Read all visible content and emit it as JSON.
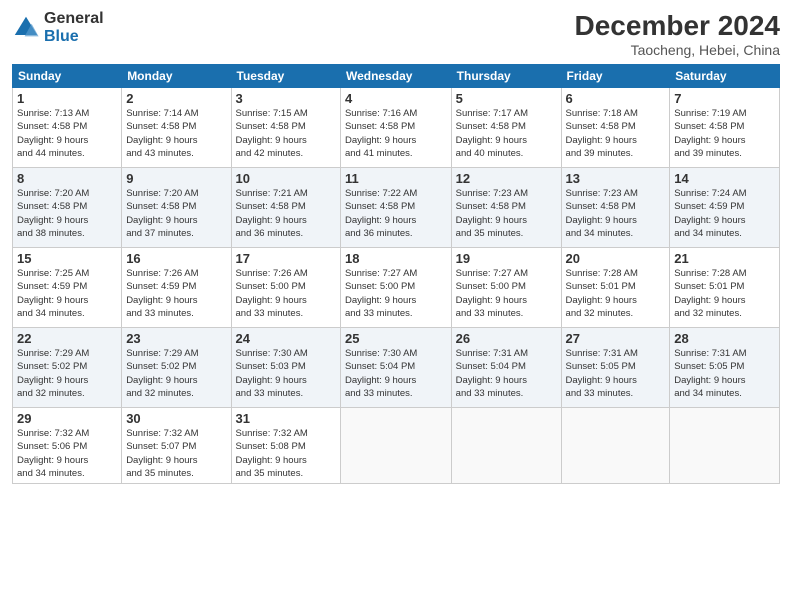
{
  "header": {
    "logo_general": "General",
    "logo_blue": "Blue",
    "month_title": "December 2024",
    "location": "Taocheng, Hebei, China"
  },
  "days_of_week": [
    "Sunday",
    "Monday",
    "Tuesday",
    "Wednesday",
    "Thursday",
    "Friday",
    "Saturday"
  ],
  "weeks": [
    [
      {
        "day": "1",
        "info": "Sunrise: 7:13 AM\nSunset: 4:58 PM\nDaylight: 9 hours\nand 44 minutes."
      },
      {
        "day": "2",
        "info": "Sunrise: 7:14 AM\nSunset: 4:58 PM\nDaylight: 9 hours\nand 43 minutes."
      },
      {
        "day": "3",
        "info": "Sunrise: 7:15 AM\nSunset: 4:58 PM\nDaylight: 9 hours\nand 42 minutes."
      },
      {
        "day": "4",
        "info": "Sunrise: 7:16 AM\nSunset: 4:58 PM\nDaylight: 9 hours\nand 41 minutes."
      },
      {
        "day": "5",
        "info": "Sunrise: 7:17 AM\nSunset: 4:58 PM\nDaylight: 9 hours\nand 40 minutes."
      },
      {
        "day": "6",
        "info": "Sunrise: 7:18 AM\nSunset: 4:58 PM\nDaylight: 9 hours\nand 39 minutes."
      },
      {
        "day": "7",
        "info": "Sunrise: 7:19 AM\nSunset: 4:58 PM\nDaylight: 9 hours\nand 39 minutes."
      }
    ],
    [
      {
        "day": "8",
        "info": "Sunrise: 7:20 AM\nSunset: 4:58 PM\nDaylight: 9 hours\nand 38 minutes."
      },
      {
        "day": "9",
        "info": "Sunrise: 7:20 AM\nSunset: 4:58 PM\nDaylight: 9 hours\nand 37 minutes."
      },
      {
        "day": "10",
        "info": "Sunrise: 7:21 AM\nSunset: 4:58 PM\nDaylight: 9 hours\nand 36 minutes."
      },
      {
        "day": "11",
        "info": "Sunrise: 7:22 AM\nSunset: 4:58 PM\nDaylight: 9 hours\nand 36 minutes."
      },
      {
        "day": "12",
        "info": "Sunrise: 7:23 AM\nSunset: 4:58 PM\nDaylight: 9 hours\nand 35 minutes."
      },
      {
        "day": "13",
        "info": "Sunrise: 7:23 AM\nSunset: 4:58 PM\nDaylight: 9 hours\nand 34 minutes."
      },
      {
        "day": "14",
        "info": "Sunrise: 7:24 AM\nSunset: 4:59 PM\nDaylight: 9 hours\nand 34 minutes."
      }
    ],
    [
      {
        "day": "15",
        "info": "Sunrise: 7:25 AM\nSunset: 4:59 PM\nDaylight: 9 hours\nand 34 minutes."
      },
      {
        "day": "16",
        "info": "Sunrise: 7:26 AM\nSunset: 4:59 PM\nDaylight: 9 hours\nand 33 minutes."
      },
      {
        "day": "17",
        "info": "Sunrise: 7:26 AM\nSunset: 5:00 PM\nDaylight: 9 hours\nand 33 minutes."
      },
      {
        "day": "18",
        "info": "Sunrise: 7:27 AM\nSunset: 5:00 PM\nDaylight: 9 hours\nand 33 minutes."
      },
      {
        "day": "19",
        "info": "Sunrise: 7:27 AM\nSunset: 5:00 PM\nDaylight: 9 hours\nand 33 minutes."
      },
      {
        "day": "20",
        "info": "Sunrise: 7:28 AM\nSunset: 5:01 PM\nDaylight: 9 hours\nand 32 minutes."
      },
      {
        "day": "21",
        "info": "Sunrise: 7:28 AM\nSunset: 5:01 PM\nDaylight: 9 hours\nand 32 minutes."
      }
    ],
    [
      {
        "day": "22",
        "info": "Sunrise: 7:29 AM\nSunset: 5:02 PM\nDaylight: 9 hours\nand 32 minutes."
      },
      {
        "day": "23",
        "info": "Sunrise: 7:29 AM\nSunset: 5:02 PM\nDaylight: 9 hours\nand 32 minutes."
      },
      {
        "day": "24",
        "info": "Sunrise: 7:30 AM\nSunset: 5:03 PM\nDaylight: 9 hours\nand 33 minutes."
      },
      {
        "day": "25",
        "info": "Sunrise: 7:30 AM\nSunset: 5:04 PM\nDaylight: 9 hours\nand 33 minutes."
      },
      {
        "day": "26",
        "info": "Sunrise: 7:31 AM\nSunset: 5:04 PM\nDaylight: 9 hours\nand 33 minutes."
      },
      {
        "day": "27",
        "info": "Sunrise: 7:31 AM\nSunset: 5:05 PM\nDaylight: 9 hours\nand 33 minutes."
      },
      {
        "day": "28",
        "info": "Sunrise: 7:31 AM\nSunset: 5:05 PM\nDaylight: 9 hours\nand 34 minutes."
      }
    ],
    [
      {
        "day": "29",
        "info": "Sunrise: 7:32 AM\nSunset: 5:06 PM\nDaylight: 9 hours\nand 34 minutes."
      },
      {
        "day": "30",
        "info": "Sunrise: 7:32 AM\nSunset: 5:07 PM\nDaylight: 9 hours\nand 35 minutes."
      },
      {
        "day": "31",
        "info": "Sunrise: 7:32 AM\nSunset: 5:08 PM\nDaylight: 9 hours\nand 35 minutes."
      },
      null,
      null,
      null,
      null
    ]
  ]
}
